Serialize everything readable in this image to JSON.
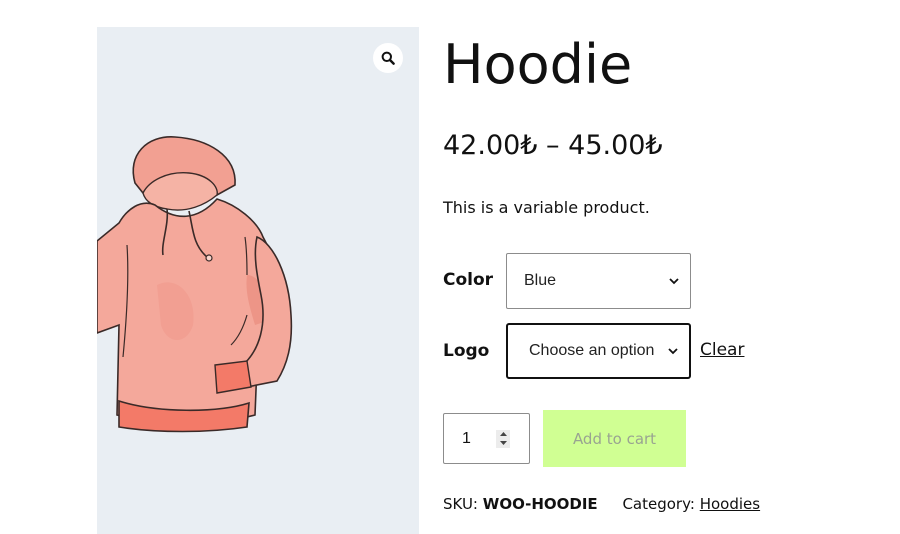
{
  "product": {
    "title": "Hoodie",
    "price_range": "42.00₺  – 45.00₺",
    "description": "This is a variable product."
  },
  "gallery": {
    "zoom_icon": "magnifier-icon",
    "background_color": "#e9eef3"
  },
  "variations": {
    "color": {
      "label": "Color",
      "selected": "Blue"
    },
    "logo": {
      "label": "Logo",
      "selected": "Choose an option"
    },
    "clear_label": "Clear"
  },
  "cart": {
    "quantity": "1",
    "add_to_cart_label": "Add to cart",
    "button_color": "#ccff88"
  },
  "meta": {
    "sku_label": "SKU:",
    "sku_value": "WOO-HOODIE",
    "category_label": "Category:",
    "category_value": "Hoodies"
  }
}
